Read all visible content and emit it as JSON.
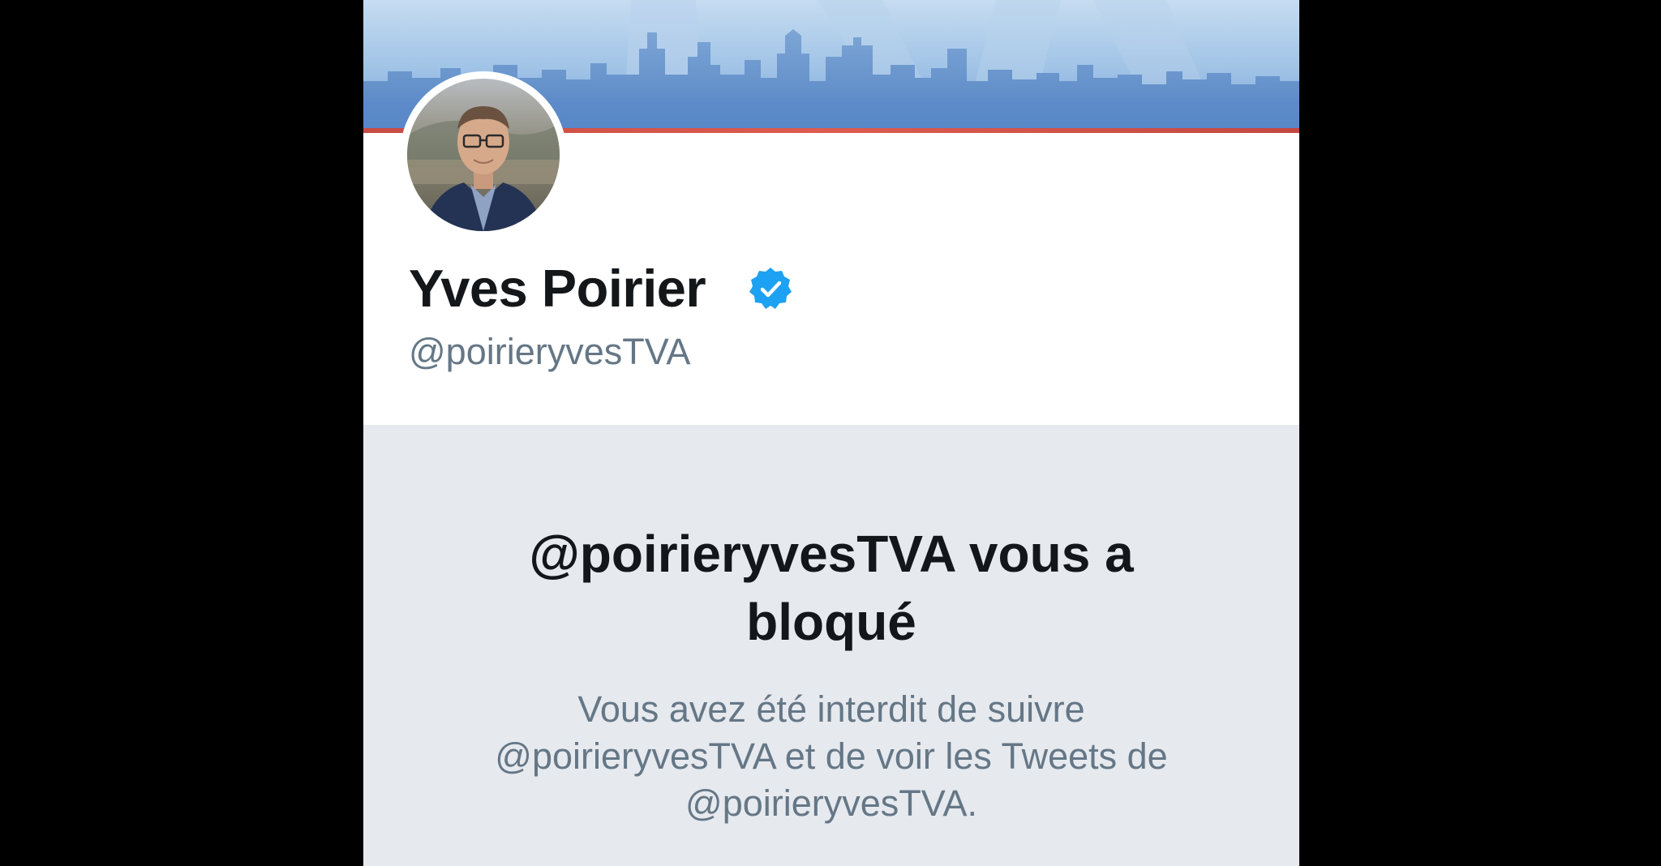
{
  "profile": {
    "display_name": "Yves Poirier",
    "handle": "@poirieryvesTVA",
    "verified": true
  },
  "blocked": {
    "title_line1": "@poirieryvesTVA vous a",
    "title_line2": "bloqué",
    "desc_line1": "Vous avez été interdit de suivre",
    "desc_line2": "@poirieryvesTVA et de voir les Tweets de",
    "desc_line3": "@poirieryvesTVA."
  },
  "icons": {
    "verified": "verified-badge-icon"
  },
  "colors": {
    "verified_blue": "#1da1f2",
    "banner_accent": "#d9574b",
    "panel_bg": "#e6e9ee",
    "secondary_text": "#657786",
    "primary_text": "#14171a"
  }
}
